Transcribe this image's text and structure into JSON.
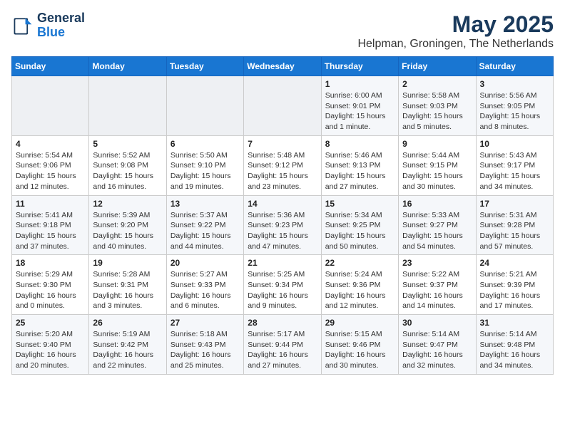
{
  "header": {
    "logo_line1": "General",
    "logo_line2": "Blue",
    "title": "May 2025",
    "subtitle": "Helpman, Groningen, The Netherlands"
  },
  "weekdays": [
    "Sunday",
    "Monday",
    "Tuesday",
    "Wednesday",
    "Thursday",
    "Friday",
    "Saturday"
  ],
  "weeks": [
    [
      {
        "day": "",
        "info": ""
      },
      {
        "day": "",
        "info": ""
      },
      {
        "day": "",
        "info": ""
      },
      {
        "day": "",
        "info": ""
      },
      {
        "day": "1",
        "info": "Sunrise: 6:00 AM\nSunset: 9:01 PM\nDaylight: 15 hours\nand 1 minute."
      },
      {
        "day": "2",
        "info": "Sunrise: 5:58 AM\nSunset: 9:03 PM\nDaylight: 15 hours\nand 5 minutes."
      },
      {
        "day": "3",
        "info": "Sunrise: 5:56 AM\nSunset: 9:05 PM\nDaylight: 15 hours\nand 8 minutes."
      }
    ],
    [
      {
        "day": "4",
        "info": "Sunrise: 5:54 AM\nSunset: 9:06 PM\nDaylight: 15 hours\nand 12 minutes."
      },
      {
        "day": "5",
        "info": "Sunrise: 5:52 AM\nSunset: 9:08 PM\nDaylight: 15 hours\nand 16 minutes."
      },
      {
        "day": "6",
        "info": "Sunrise: 5:50 AM\nSunset: 9:10 PM\nDaylight: 15 hours\nand 19 minutes."
      },
      {
        "day": "7",
        "info": "Sunrise: 5:48 AM\nSunset: 9:12 PM\nDaylight: 15 hours\nand 23 minutes."
      },
      {
        "day": "8",
        "info": "Sunrise: 5:46 AM\nSunset: 9:13 PM\nDaylight: 15 hours\nand 27 minutes."
      },
      {
        "day": "9",
        "info": "Sunrise: 5:44 AM\nSunset: 9:15 PM\nDaylight: 15 hours\nand 30 minutes."
      },
      {
        "day": "10",
        "info": "Sunrise: 5:43 AM\nSunset: 9:17 PM\nDaylight: 15 hours\nand 34 minutes."
      }
    ],
    [
      {
        "day": "11",
        "info": "Sunrise: 5:41 AM\nSunset: 9:18 PM\nDaylight: 15 hours\nand 37 minutes."
      },
      {
        "day": "12",
        "info": "Sunrise: 5:39 AM\nSunset: 9:20 PM\nDaylight: 15 hours\nand 40 minutes."
      },
      {
        "day": "13",
        "info": "Sunrise: 5:37 AM\nSunset: 9:22 PM\nDaylight: 15 hours\nand 44 minutes."
      },
      {
        "day": "14",
        "info": "Sunrise: 5:36 AM\nSunset: 9:23 PM\nDaylight: 15 hours\nand 47 minutes."
      },
      {
        "day": "15",
        "info": "Sunrise: 5:34 AM\nSunset: 9:25 PM\nDaylight: 15 hours\nand 50 minutes."
      },
      {
        "day": "16",
        "info": "Sunrise: 5:33 AM\nSunset: 9:27 PM\nDaylight: 15 hours\nand 54 minutes."
      },
      {
        "day": "17",
        "info": "Sunrise: 5:31 AM\nSunset: 9:28 PM\nDaylight: 15 hours\nand 57 minutes."
      }
    ],
    [
      {
        "day": "18",
        "info": "Sunrise: 5:29 AM\nSunset: 9:30 PM\nDaylight: 16 hours\nand 0 minutes."
      },
      {
        "day": "19",
        "info": "Sunrise: 5:28 AM\nSunset: 9:31 PM\nDaylight: 16 hours\nand 3 minutes."
      },
      {
        "day": "20",
        "info": "Sunrise: 5:27 AM\nSunset: 9:33 PM\nDaylight: 16 hours\nand 6 minutes."
      },
      {
        "day": "21",
        "info": "Sunrise: 5:25 AM\nSunset: 9:34 PM\nDaylight: 16 hours\nand 9 minutes."
      },
      {
        "day": "22",
        "info": "Sunrise: 5:24 AM\nSunset: 9:36 PM\nDaylight: 16 hours\nand 12 minutes."
      },
      {
        "day": "23",
        "info": "Sunrise: 5:22 AM\nSunset: 9:37 PM\nDaylight: 16 hours\nand 14 minutes."
      },
      {
        "day": "24",
        "info": "Sunrise: 5:21 AM\nSunset: 9:39 PM\nDaylight: 16 hours\nand 17 minutes."
      }
    ],
    [
      {
        "day": "25",
        "info": "Sunrise: 5:20 AM\nSunset: 9:40 PM\nDaylight: 16 hours\nand 20 minutes."
      },
      {
        "day": "26",
        "info": "Sunrise: 5:19 AM\nSunset: 9:42 PM\nDaylight: 16 hours\nand 22 minutes."
      },
      {
        "day": "27",
        "info": "Sunrise: 5:18 AM\nSunset: 9:43 PM\nDaylight: 16 hours\nand 25 minutes."
      },
      {
        "day": "28",
        "info": "Sunrise: 5:17 AM\nSunset: 9:44 PM\nDaylight: 16 hours\nand 27 minutes."
      },
      {
        "day": "29",
        "info": "Sunrise: 5:15 AM\nSunset: 9:46 PM\nDaylight: 16 hours\nand 30 minutes."
      },
      {
        "day": "30",
        "info": "Sunrise: 5:14 AM\nSunset: 9:47 PM\nDaylight: 16 hours\nand 32 minutes."
      },
      {
        "day": "31",
        "info": "Sunrise: 5:14 AM\nSunset: 9:48 PM\nDaylight: 16 hours\nand 34 minutes."
      }
    ]
  ]
}
